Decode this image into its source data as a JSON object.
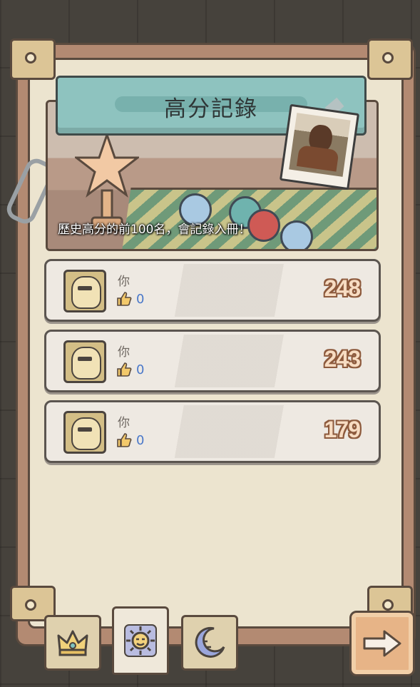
{
  "header": {
    "title": "高分記錄"
  },
  "banner": {
    "subtitle": "歷史高分的前100名，會記錄入冊！"
  },
  "records": [
    {
      "name": "你",
      "likes": "0",
      "score": "248"
    },
    {
      "name": "你",
      "likes": "0",
      "score": "243"
    },
    {
      "name": "你",
      "likes": "0",
      "score": "179"
    }
  ],
  "tabs": [
    {
      "icon": "crown-icon",
      "active": false
    },
    {
      "icon": "sun-face-icon",
      "active": true
    },
    {
      "icon": "moon-face-icon",
      "active": false
    }
  ],
  "next_button": {
    "icon": "arrow-right-icon"
  },
  "colors": {
    "title_bar": "#8ec3bf",
    "score_text": "#f7dcc2",
    "score_outline": "#8d5a3d",
    "like_count": "#4a78c9"
  }
}
